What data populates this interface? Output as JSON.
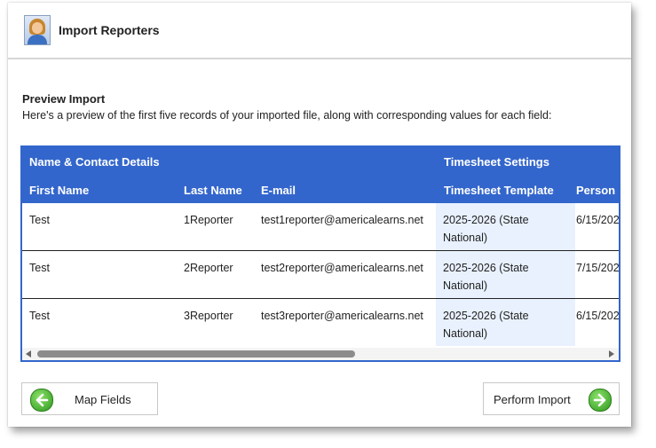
{
  "header": {
    "title": "Import Reporters",
    "icon": "reporter-avatar-icon"
  },
  "preview": {
    "title": "Preview Import",
    "description": "Here's a preview of the first five records of your imported file, along with corresponding values for each field:"
  },
  "table": {
    "groups": [
      "Name & Contact Details",
      "Timesheet Settings"
    ],
    "columns": [
      "First Name",
      "Last Name",
      "E-mail",
      "Timesheet Template",
      "Person"
    ],
    "rows": [
      [
        "Test",
        "1Reporter",
        "test1reporter@americalearns.net",
        "2025-2026 (State National)",
        "6/15/202"
      ],
      [
        "Test",
        "2Reporter",
        "test2reporter@americalearns.net",
        "2025-2026 (State National)",
        "7/15/202"
      ],
      [
        "Test",
        "3Reporter",
        "test3reporter@americalearns.net",
        "2025-2026 (State National)",
        "6/15/202"
      ]
    ]
  },
  "buttons": {
    "map_fields": "Map Fields",
    "perform_import": "Perform Import"
  },
  "colors": {
    "header_blue": "#3366cc",
    "highlight_cell": "#e8f1fd",
    "go_green": "#3aa524"
  }
}
